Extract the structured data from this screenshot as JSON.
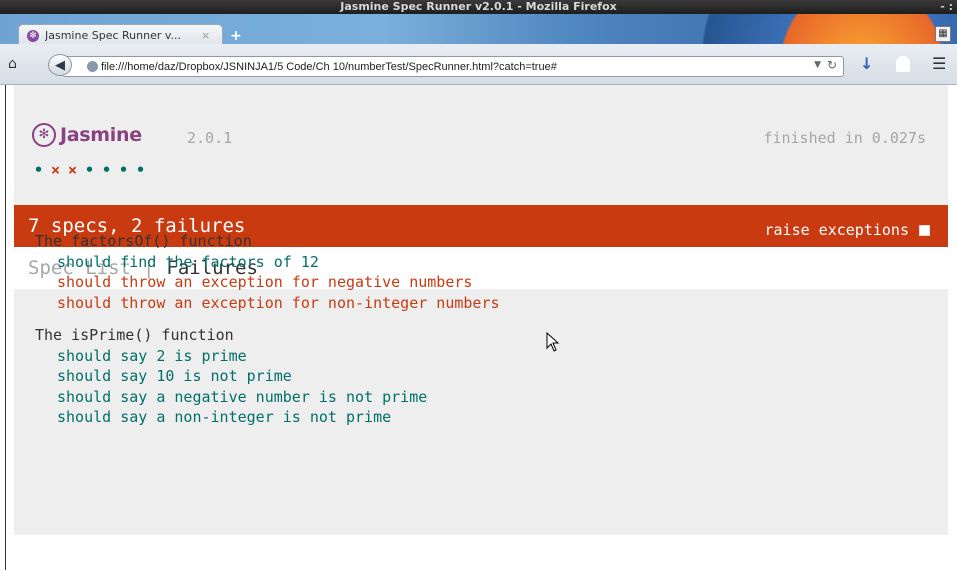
{
  "window": {
    "title": "Jasmine Spec Runner v2.0.1 - Mozilla Firefox",
    "controls": "- :"
  },
  "tab": {
    "label": "Jasmine Spec Runner v...",
    "close": "×",
    "new_tab": "+"
  },
  "url": {
    "value": "file:///home/daz/Dropbox/JSNINJA1/5 Code/Ch 10/numberTest/SpecRunner.html?catch=true#"
  },
  "jasmine": {
    "logo_text": "Jasmine",
    "version": "2.0.1",
    "duration": "finished in 0.027s",
    "symbol_summary": [
      "passed",
      "failed",
      "failed",
      "passed",
      "passed",
      "passed",
      "passed"
    ],
    "symbols": {
      "passed": "•",
      "failed": "×"
    },
    "alert": "7 specs, 2 failures",
    "raise_exceptions": "raise exceptions",
    "menu": {
      "spec_list": "Spec List",
      "separator": "|",
      "failures": "Failures"
    }
  },
  "suites": [
    {
      "description": "The factorsOf() function",
      "specs": [
        {
          "text": "should find the factors of 12",
          "status": "passed"
        },
        {
          "text": "should throw an exception for negative numbers",
          "status": "failed"
        },
        {
          "text": "should throw an exception for non-integer numbers",
          "status": "failed"
        }
      ]
    },
    {
      "description": "The isPrime() function",
      "specs": [
        {
          "text": "should say 2 is prime",
          "status": "passed"
        },
        {
          "text": "should say 10 is not prime",
          "status": "passed"
        },
        {
          "text": "should say a negative number is not prime",
          "status": "passed"
        },
        {
          "text": "should say a non-integer is not prime",
          "status": "passed"
        }
      ]
    }
  ],
  "colors": {
    "passed": "#007069",
    "failed": "#ca3a11",
    "logo": "#8a4182",
    "muted": "#a6a6a6"
  }
}
